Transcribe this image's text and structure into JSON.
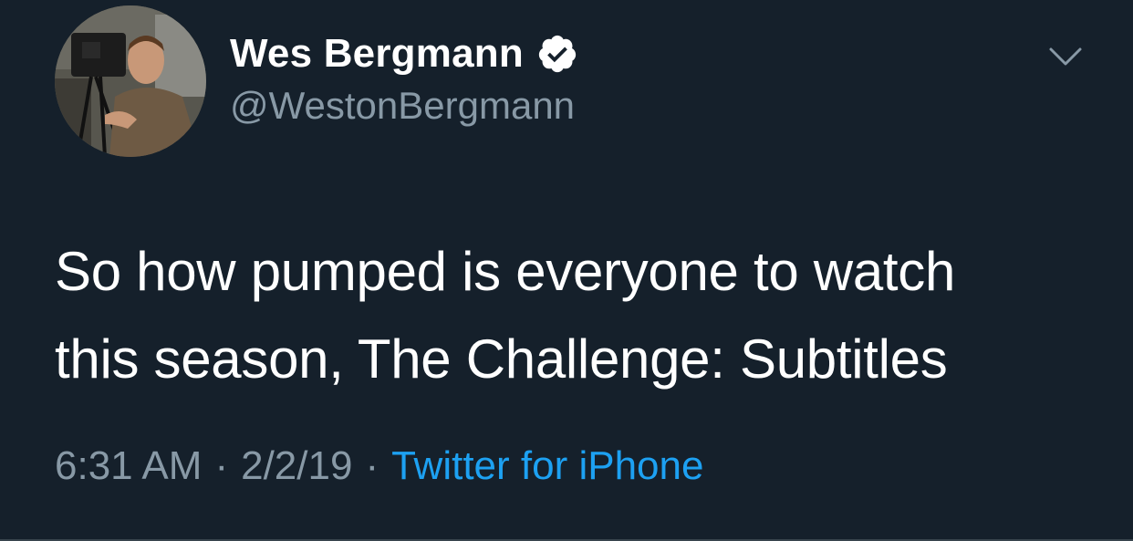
{
  "tweet": {
    "author": {
      "display_name": "Wes Bergmann",
      "handle": "@WestonBergmann",
      "verified": true,
      "avatar_icon": "profile-photo"
    },
    "text_lines": [
      "So how pumped is everyone to watch",
      "this season, The Challenge: Subtitles"
    ],
    "meta": {
      "time": "6:31 AM",
      "separator": "·",
      "date": "2/2/19",
      "source": "Twitter for iPhone"
    },
    "menu_icon": "chevron-down-icon"
  },
  "colors": {
    "background": "#15202b",
    "text_primary": "#ffffff",
    "text_secondary": "#8899a6",
    "accent_link": "#1da1f2",
    "divider": "#38444d"
  }
}
